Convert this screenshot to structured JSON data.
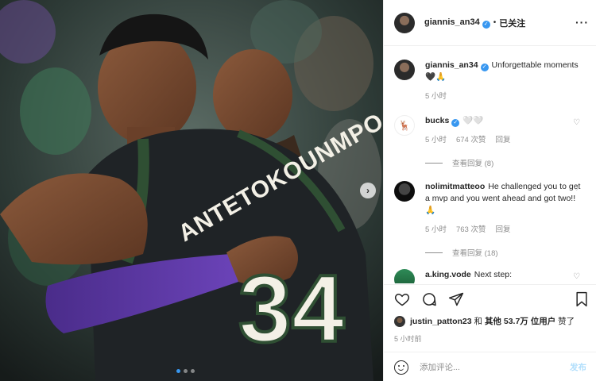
{
  "post": {
    "username": "giannis_an34",
    "separator": "•",
    "follow_label": "已关注",
    "more_icon": "more-horizontal-icon",
    "jersey_name": "ANTETOKOUNMPO",
    "jersey_number": "34",
    "carousel_dots": 3,
    "active_dot": 0
  },
  "caption": {
    "username": "giannis_an34",
    "text": "Unforgettable moments 🖤🙏",
    "time": "5 小时"
  },
  "comments": [
    {
      "username": "bucks",
      "verified": true,
      "text": "🤍🤍",
      "time": "5 小时",
      "likes": "674 次赞",
      "reply_label": "回复",
      "view_replies": "查看回复 (8)"
    },
    {
      "username": "nolimitmatteoo",
      "verified": false,
      "text": "He challenged you to get a mvp and you went ahead and got two!! 🙏",
      "time": "5 小时",
      "likes": "763 次赞",
      "reply_label": "回复",
      "view_replies": "查看回复 (18)"
    },
    {
      "username": "a.king.vode",
      "verified": false,
      "text": "Next step:"
    }
  ],
  "likes": {
    "first_liker": "justin_patton23",
    "connector": "和",
    "others": "其他 53.7万 位用户",
    "suffix": "赞了"
  },
  "timestamp": "5 小时前",
  "add_comment": {
    "placeholder": "添加评论...",
    "post_label": "发布"
  },
  "colors": {
    "accent": "#3897f0",
    "post_button_disabled": "#b2dffc",
    "muted_text": "#8e8e8e",
    "text": "#262626"
  }
}
